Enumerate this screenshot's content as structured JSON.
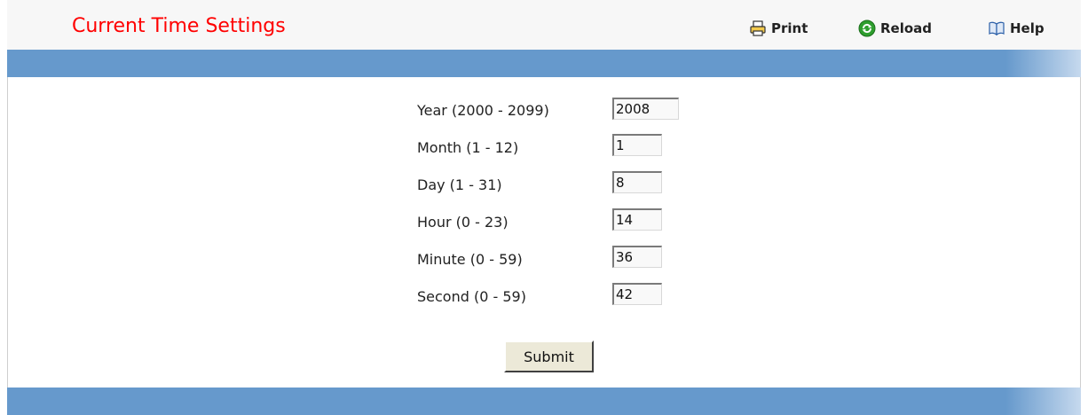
{
  "header": {
    "title": "Current Time Settings",
    "toolbar": {
      "print_label": "Print",
      "reload_label": "Reload",
      "help_label": "Help"
    }
  },
  "form": {
    "fields": [
      {
        "label": "Year (2000 - 2099)",
        "value": "2008"
      },
      {
        "label": "Month (1 - 12)",
        "value": "1"
      },
      {
        "label": "Day (1 - 31)",
        "value": "8"
      },
      {
        "label": "Hour (0 - 23)",
        "value": "14"
      },
      {
        "label": "Minute (0 - 59)",
        "value": "36"
      },
      {
        "label": "Second (0 - 59)",
        "value": "42"
      }
    ],
    "submit_label": "Submit"
  },
  "colors": {
    "title": "#ff0000",
    "bar": "#6699cc",
    "reload_icon": "#2e9e2e"
  },
  "icons": {
    "print": "printer-icon",
    "reload": "reload-icon",
    "help": "book-icon"
  }
}
